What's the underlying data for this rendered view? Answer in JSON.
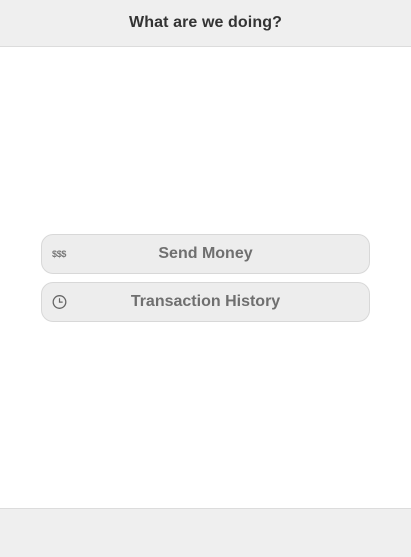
{
  "header": {
    "title": "What are we doing?"
  },
  "menu": {
    "items": [
      {
        "label": "Send Money",
        "icon": "dollar-icon",
        "icon_text": "$$$"
      },
      {
        "label": "Transaction History",
        "icon": "clock-icon"
      }
    ]
  },
  "colors": {
    "bar_background": "#efefef",
    "button_background": "#ededed",
    "button_text": "#6f6f6f",
    "title_text": "#333333"
  }
}
